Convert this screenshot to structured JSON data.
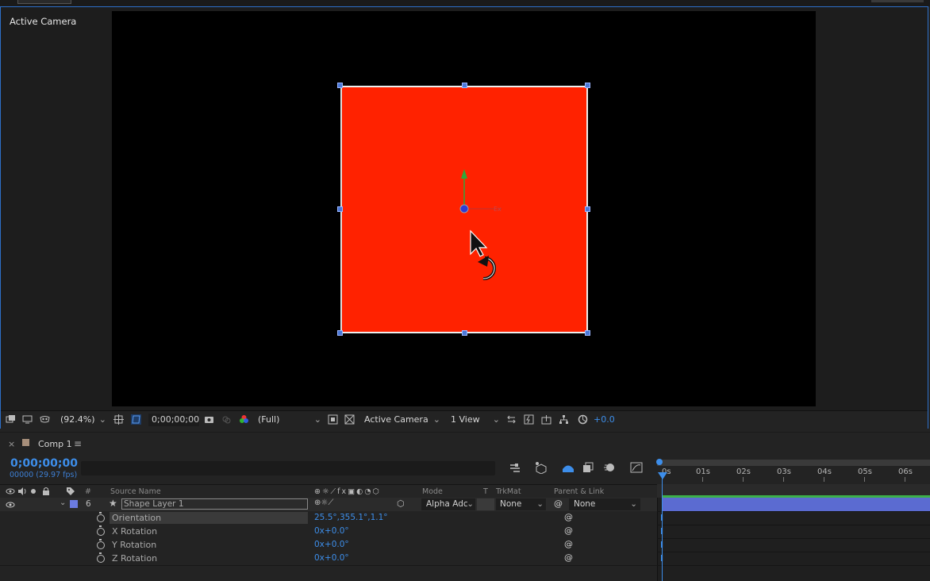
{
  "viewer": {
    "label": "Active Camera",
    "toolbar": {
      "zoom": "(92.4%)",
      "timecode": "0;00;00;00",
      "resolution": "(Full)",
      "view": "Active Camera",
      "layout": "1 View",
      "exposure": "+0.0"
    }
  },
  "timeline": {
    "comp_name": "Comp 1",
    "timecode": "0;00;00;00",
    "frames": "00000 (29.97 fps)",
    "search_placeholder": "",
    "columns": {
      "num": "#",
      "source_name": "Source Name",
      "mode": "Mode",
      "t": "T",
      "trkmat": "TrkMat",
      "parent": "Parent & Link"
    },
    "layer": {
      "index": "6",
      "name": "Shape Layer 1",
      "mode": "Alpha Adc",
      "trkmat": "None",
      "parent": "None"
    },
    "properties": [
      {
        "name": "Orientation",
        "value": "25.5°,355.1°,1.1°"
      },
      {
        "name": "X Rotation",
        "value": "0x+0.0°"
      },
      {
        "name": "Y Rotation",
        "value": "0x+0.0°"
      },
      {
        "name": "Z Rotation",
        "value": "0x+0.0°"
      }
    ],
    "ruler": [
      "0s",
      "01s",
      "02s",
      "03s",
      "04s",
      "05s",
      "06s"
    ]
  },
  "colors": {
    "accent": "#3d8eea",
    "layer_fill": "#ff2200",
    "layer_bar": "#5b6bd1",
    "label_color": "#6b7be0"
  }
}
